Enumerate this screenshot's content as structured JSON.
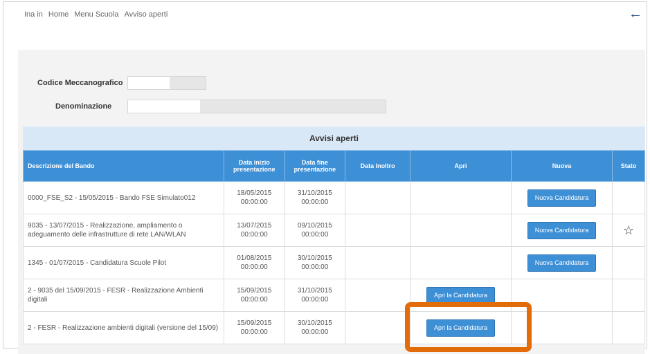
{
  "breadcrumb": [
    "Ina in",
    "Home",
    "Menu Scuola",
    "Avviso aperti"
  ],
  "form": {
    "codice_label": "Codice Meccanografico",
    "codice_value": "",
    "denominazione_label": "Denominazione",
    "denominazione_value": ""
  },
  "table": {
    "caption": "Avvisi aperti",
    "headers": [
      "Descrizione del Bando",
      "Data inizio presentazione",
      "Data fine presentazione",
      "Data Inoltro",
      "Apri",
      "Nuova",
      "Stato"
    ],
    "rows": [
      {
        "desc": "0000_FSE_S2 - 15/05/2015 - Bando FSE Simulato012",
        "start": "18/05/2015 00:00:00",
        "end": "31/10/2015 00:00:00",
        "inoltro": "",
        "apri": "",
        "nuova": "Nuova Candidatura",
        "stato": ""
      },
      {
        "desc": "9035 - 13/07/2015 - Realizzazione, ampliamento o adeguamento delle infrastrutture di rete LAN/WLAN",
        "start": "13/07/2015 00:00:00",
        "end": "09/10/2015 00:00:00",
        "inoltro": "",
        "apri": "",
        "nuova": "Nuova Candidatura",
        "stato": "star"
      },
      {
        "desc": "1345 - 01/07/2015 - Candidatura Scuole Pilot",
        "start": "01/08/2015 00:00:00",
        "end": "30/10/2015 00:00:00",
        "inoltro": "",
        "apri": "",
        "nuova": "Nuova Candidatura",
        "stato": ""
      },
      {
        "desc": "2 - 9035 del 15/09/2015 - FESR - Realizzazione Ambienti digitali",
        "start": "15/09/2015 00:00:00",
        "end": "31/10/2015 00:00:00",
        "inoltro": "",
        "apri": "Apri la Candidatura",
        "nuova": "",
        "stato": ""
      },
      {
        "desc": "2 - FESR - Realizzazione ambienti digitali (versione del 15/09)",
        "start": "15/09/2015 00:00:00",
        "end": "30/10/2015 00:00:00",
        "inoltro": "",
        "apri": "Apri la Candidatura",
        "nuova": "",
        "stato": ""
      }
    ]
  },
  "colors": {
    "header_blue": "#3d8fd6",
    "caption_bg": "#d9e8f7",
    "highlight": "#e36c0a"
  },
  "icons": {
    "back": "arrow-left-icon",
    "star": "star-icon"
  }
}
